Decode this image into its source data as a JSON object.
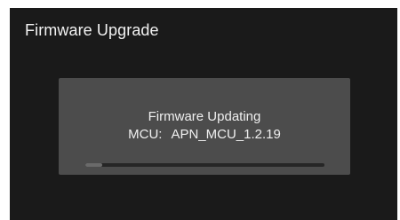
{
  "screen": {
    "title": "Firmware Upgrade"
  },
  "dialog": {
    "status": "Firmware Updating",
    "component_label": "MCU:",
    "component_version": "APN_MCU_1.2.19",
    "progress_fraction": 0.07
  },
  "colors": {
    "background": "#1a1a1a",
    "dialog": "#4c4c4c",
    "text": "#f0f0f0",
    "progress_track": "#262626",
    "progress_fill": "#6a6a6a"
  }
}
